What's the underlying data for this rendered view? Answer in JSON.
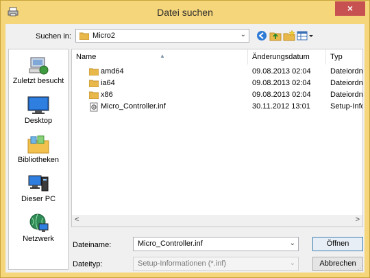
{
  "window": {
    "title": "Datei suchen",
    "close_label": "×"
  },
  "lookin": {
    "label": "Suchen in:",
    "value": "Micro2",
    "arrow": "⌄"
  },
  "places": [
    {
      "label": "Zuletzt besucht"
    },
    {
      "label": "Desktop"
    },
    {
      "label": "Bibliotheken"
    },
    {
      "label": "Dieser PC"
    },
    {
      "label": "Netzwerk"
    }
  ],
  "columns": {
    "name": "Name",
    "date": "Änderungsdatum",
    "type": "Typ"
  },
  "files": [
    {
      "name": "amd64",
      "date": "09.08.2013 02:04",
      "type": "Dateiordner",
      "kind": "folder"
    },
    {
      "name": "ia64",
      "date": "09.08.2013 02:04",
      "type": "Dateiordner",
      "kind": "folder"
    },
    {
      "name": "x86",
      "date": "09.08.2013 02:04",
      "type": "Dateiordner",
      "kind": "folder"
    },
    {
      "name": "Micro_Controller.inf",
      "date": "30.11.2012 13:01",
      "type": "Setup-Informationen",
      "kind": "inf"
    }
  ],
  "scroll": {
    "left": "<",
    "right": ">"
  },
  "filename": {
    "label": "Dateiname:",
    "value": "Micro_Controller.inf",
    "arrow": "⌄"
  },
  "filetype": {
    "label": "Dateityp:",
    "value": "Setup-Informationen (*.inf)",
    "arrow": "⌄"
  },
  "buttons": {
    "open": "Öffnen",
    "cancel": "Abbrechen"
  },
  "colors": {
    "titlebar": "#f6d67a",
    "close": "#c75050",
    "folder": "#e8b84a"
  }
}
